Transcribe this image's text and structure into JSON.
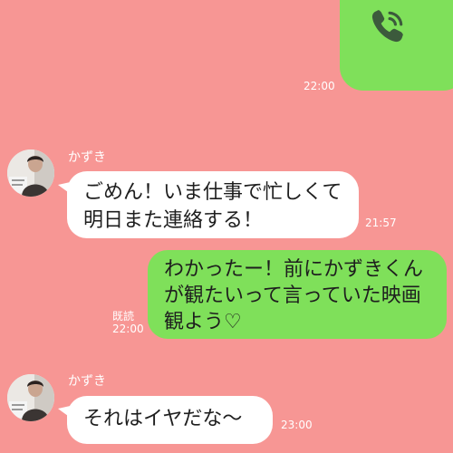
{
  "call": {
    "icon": "phone-icon",
    "time": "22:00"
  },
  "messages": [
    {
      "sender": "かずき",
      "text": "ごめん！いま仕事で忙しくて明日また連絡する！",
      "time": "21:57"
    },
    {
      "text": "わかったー！前にかずきくんが観たいって言っていた映画観よう♡",
      "read_label": "既読",
      "time": "22:00"
    },
    {
      "sender": "かずき",
      "text": "それはイヤだな〜",
      "time": "23:00"
    }
  ],
  "colors": {
    "background": "#f79694",
    "sent_bubble": "#7fe05a",
    "received_bubble": "#ffffff"
  }
}
